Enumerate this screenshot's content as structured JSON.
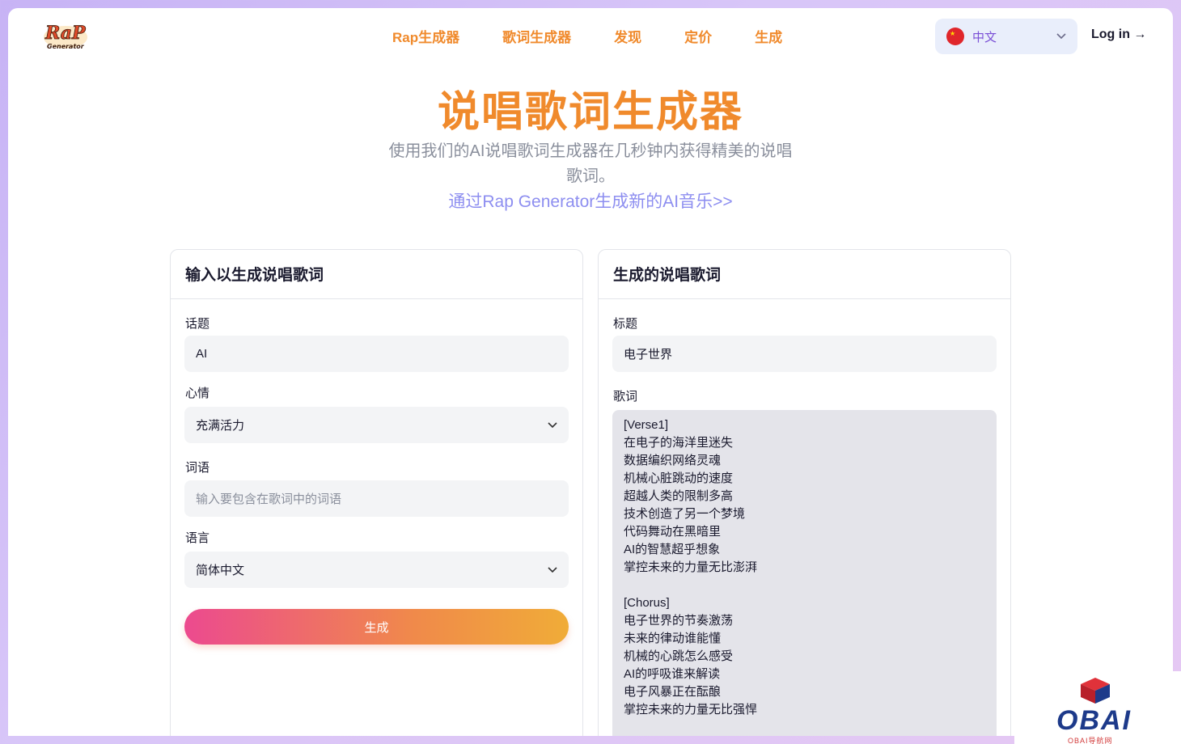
{
  "nav": {
    "items": [
      "Rap生成器",
      "歌词生成器",
      "发现",
      "定价",
      "生成"
    ]
  },
  "language": {
    "label": "中文"
  },
  "login": {
    "label": "Log in →"
  },
  "hero": {
    "title": "说唱歌词生成器",
    "subtitle": "使用我们的AI说唱歌词生成器在几秒钟内获得精美的说唱歌词。",
    "link": "通过Rap Generator生成新的AI音乐>>"
  },
  "input_card": {
    "title": "输入以生成说唱歌词",
    "topic_label": "话题",
    "topic_value": "AI",
    "mood_label": "心情",
    "mood_value": "充满活力",
    "words_label": "词语",
    "words_placeholder": "输入要包含在歌词中的词语",
    "language_label": "语言",
    "language_value": "简体中文",
    "generate_label": "生成"
  },
  "output_card": {
    "title": "生成的说唱歌词",
    "title_label": "标题",
    "title_value": "电子世界",
    "lyrics_label": "歌词",
    "lyrics": [
      "[Verse1]",
      "在电子的海洋里迷失",
      "数据编织网络灵魂",
      "机械心脏跳动的速度",
      "超越人类的限制多高",
      "技术创造了另一个梦境",
      "代码舞动在黑暗里",
      "AI的智慧超乎想象",
      "掌控未来的力量无比澎湃",
      "",
      "[Chorus]",
      "电子世界的节奏激荡",
      "未来的律动谁能懂",
      "机械的心跳怎么感受",
      "AI的呼吸谁来解读",
      "电子风暴正在酝酿",
      "掌控未来的力量无比强悍"
    ]
  },
  "watermark": {
    "brand": "OBAI",
    "sub": "OBAI导航网"
  },
  "colors": {
    "accent": "#f08a2c",
    "link": "#8d8ef0",
    "language_text": "#7a4fd6"
  }
}
